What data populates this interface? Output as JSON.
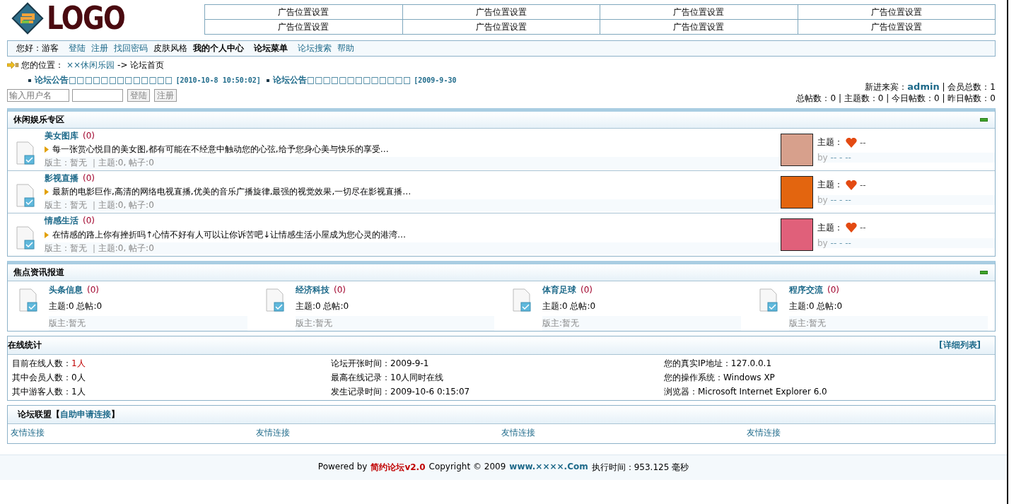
{
  "logo": {
    "text": "LOGO"
  },
  "ads": [
    [
      "广告位置设置",
      "广告位置设置",
      "广告位置设置",
      "广告位置设置"
    ],
    [
      "广告位置设置",
      "广告位置设置",
      "广告位置设置",
      "广告位置设置"
    ]
  ],
  "nav": [
    {
      "kind": "text",
      "label": "您好：游客"
    },
    {
      "kind": "link",
      "label": "登陆"
    },
    {
      "kind": "link",
      "label": "注册"
    },
    {
      "kind": "link",
      "label": "找回密码"
    },
    {
      "kind": "plain",
      "label": "皮肤风格"
    },
    {
      "kind": "bold",
      "label": "我的个人中心"
    },
    {
      "kind": "bold",
      "label": "论坛菜单"
    },
    {
      "kind": "link",
      "label": "论坛搜索"
    },
    {
      "kind": "link",
      "label": "帮助"
    }
  ],
  "location": {
    "label": "您的位置：",
    "path": "××休闲乐园",
    "current": "-> 论坛首页"
  },
  "announcements": [
    {
      "title": "论坛公告□□□□□□□□□□□□□",
      "date": "[2010-10-8 10:50:02]"
    },
    {
      "title": "论坛公告□□□□□□□□□□□□□",
      "date": "[2009-9-30"
    }
  ],
  "login": {
    "placeholder": "输入用户名",
    "buttons": [
      "登陆",
      "注册"
    ]
  },
  "stats": {
    "newest_label": "新进来宾：",
    "newest": "admin",
    "line1_rest": "| 会员总数：1",
    "line2": "总帖数：0 | 主题数：0 | 今日帖数：0 | 昨日帖数：0"
  },
  "section1": {
    "title": "休闲娱乐专区",
    "boards": [
      {
        "name": "美女图库",
        "count": "(0)",
        "desc": "每一张赏心悦目的美女图,都有可能在不经意中触动您的心弦,给予您身心美与快乐的享受…",
        "meta": "版主：暂无 ｜主题:0, 帖子:0",
        "topic_label": "主题：",
        "topic": "--",
        "by": "by",
        "by_value": "-- - --"
      },
      {
        "name": "影视直播",
        "count": "(0)",
        "desc": "最新的电影巨作,高清的网络电视直播,优美的音乐广播旋律,最强的视觉效果,一切尽在影视直播…",
        "meta": "版主：暂无 ｜主题:0, 帖子:0",
        "topic_label": "主题：",
        "topic": "--",
        "by": "by",
        "by_value": "-- - --"
      },
      {
        "name": "情感生活",
        "count": "(0)",
        "desc": "在情感的路上你有挫折吗↑心情不好有人可以让你诉苦吧↓让情感生活小屋成为您心灵的港湾…",
        "meta": "版主：暂无 ｜主题:0, 帖子:0",
        "topic_label": "主题：",
        "topic": "--",
        "by": "by",
        "by_value": "-- - --"
      }
    ]
  },
  "section2": {
    "title": "焦点资讯报道",
    "boards": [
      {
        "name": "头条信息",
        "count": "(0)",
        "stats": "主题:0 总帖:0",
        "meta": "版主:暂无"
      },
      {
        "name": "经济科技",
        "count": "(0)",
        "stats": "主题:0 总帖:0",
        "meta": "版主:暂无"
      },
      {
        "name": "体育足球",
        "count": "(0)",
        "stats": "主题:0 总帖:0",
        "meta": "版主:暂无"
      },
      {
        "name": "程序交流",
        "count": "(0)",
        "stats": "主题:0 总帖:0",
        "meta": "版主:暂无"
      }
    ]
  },
  "online": {
    "title": "在线统计",
    "detail_link": "[详细列表]",
    "columns": [
      [
        {
          "label": "目前在线人数：",
          "value": "1人",
          "highlight": true
        },
        {
          "label": "其中会员人数：",
          "value": "0人",
          "highlight": false
        },
        {
          "label": "其中游客人数：",
          "value": "1人",
          "highlight": false
        }
      ],
      [
        {
          "label": "论坛开张时间：",
          "value": "2009-9-1",
          "highlight": false
        },
        {
          "label": "最高在线记录：",
          "value": "10人同时在线",
          "highlight": false
        },
        {
          "label": "发生记录时间：",
          "value": "2009-10-6 0:15:07",
          "highlight": false
        }
      ],
      [
        {
          "label": "您的真实IP地址：",
          "value": "127.0.0.1",
          "highlight": false
        },
        {
          "label": "您的操作系统：",
          "value": "Windows XP",
          "highlight": false
        },
        {
          "label": "浏览器：",
          "value": "Microsoft Internet Explorer 6.0",
          "highlight": false
        }
      ]
    ]
  },
  "links": {
    "title": "论坛联盟【",
    "apply": "自助申请连接",
    "title_end": "】",
    "items": [
      "友情连接",
      "友情连接",
      "友情连接",
      "友情连接"
    ]
  },
  "footer": {
    "powered": "Powered by",
    "brand": "简约论坛v2.0",
    "copyright": "Copyright © 2009",
    "site": "www.××××.Com",
    "time": "执行时间：953.125 毫秒"
  }
}
